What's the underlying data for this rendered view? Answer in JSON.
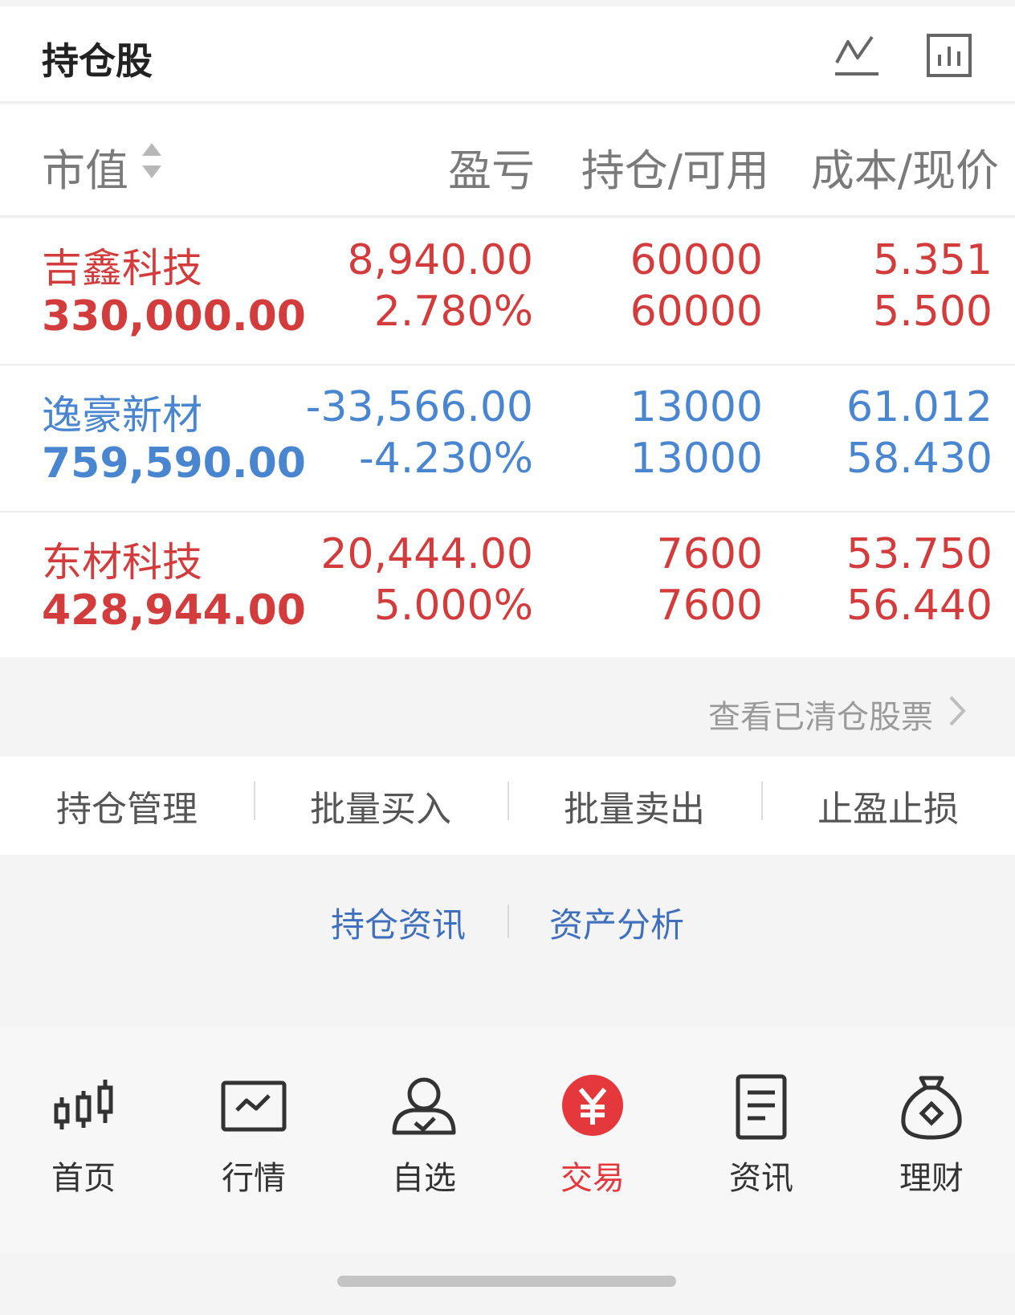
{
  "header": {
    "title": "持仓股",
    "icons": [
      "line-chart-icon",
      "bar-chart-icon"
    ]
  },
  "columns": {
    "market": "市值",
    "pnl": "盈亏",
    "position": "持仓/可用",
    "cost": "成本/现价"
  },
  "holdings": [
    {
      "name": "吉鑫科技",
      "market_value": "330,000.00",
      "pnl": "8,940.00",
      "pnl_pct": "2.780%",
      "position": "60000",
      "available": "60000",
      "cost": "5.351",
      "price": "5.500",
      "trend": "up"
    },
    {
      "name": "逸豪新材",
      "market_value": "759,590.00",
      "pnl": "-33,566.00",
      "pnl_pct": "-4.230%",
      "position": "13000",
      "available": "13000",
      "cost": "61.012",
      "price": "58.430",
      "trend": "down"
    },
    {
      "name": "东材科技",
      "market_value": "428,944.00",
      "pnl": "20,444.00",
      "pnl_pct": "5.000%",
      "position": "7600",
      "available": "7600",
      "cost": "53.750",
      "price": "56.440",
      "trend": "up"
    }
  ],
  "cleared_link": "查看已清仓股票",
  "actions": [
    "持仓管理",
    "批量买入",
    "批量卖出",
    "止盈止损"
  ],
  "links": {
    "news": "持仓资讯",
    "analysis": "资产分析"
  },
  "nav": [
    {
      "label": "首页",
      "icon": "candlestick-icon",
      "active": false
    },
    {
      "label": "行情",
      "icon": "market-chart-icon",
      "active": false
    },
    {
      "label": "自选",
      "icon": "user-check-icon",
      "active": false
    },
    {
      "label": "交易",
      "icon": "yuan-icon",
      "active": true
    },
    {
      "label": "资讯",
      "icon": "document-icon",
      "active": false
    },
    {
      "label": "理财",
      "icon": "money-bag-icon",
      "active": false
    }
  ],
  "colors": {
    "up": "#d23c3c",
    "down": "#4a86cf",
    "active_tab": "#e5383d",
    "link": "#3f6fbd"
  }
}
